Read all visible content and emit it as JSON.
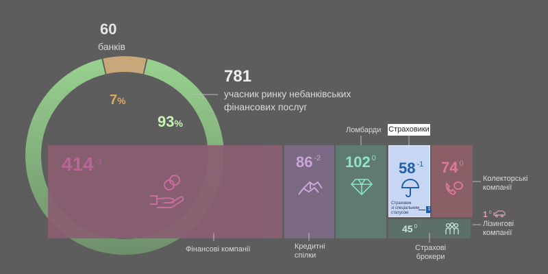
{
  "chart_data": {
    "type": "pie",
    "slices": [
      {
        "name": "банків",
        "count": 60,
        "percent": 7,
        "color": "#c8a87a"
      },
      {
        "name": "учасник ринку небанківських фінансових послуг",
        "count": 781,
        "percent": 93,
        "color": "#8fc28a"
      }
    ],
    "breakdown": {
      "type": "treemap",
      "items": [
        {
          "label": "Фінансові компанії",
          "value": 414,
          "change": "-3",
          "color": "#8a5f72",
          "text_color": "#c0679a",
          "icon": "hand-coins-icon"
        },
        {
          "label": "Кредитні спілки",
          "value": 86,
          "change": "-2",
          "color": "#7b6882",
          "text_color": "#c9a6d6",
          "icon": "handshake-icon"
        },
        {
          "label": "Ломбарди",
          "value": 102,
          "change": "0",
          "color": "#5f7a72",
          "text_color": "#8fe3c9",
          "icon": "diamond-icon"
        },
        {
          "label": "Страховики",
          "value": 58,
          "change": "-1",
          "color": "#c6d6f3",
          "text_color": "#1f5ea8",
          "icon": "umbrella-icon",
          "highlighted": true,
          "note": "Страховик зі спеціальним статусом",
          "note_value": 1
        },
        {
          "label": "Колекторські компанії",
          "value": 74,
          "change": "0",
          "color": "#8a5f66",
          "text_color": "#e07a9a",
          "icon": "phone-chat-icon"
        },
        {
          "label": "Страхові брокери",
          "value": 45,
          "change": "0",
          "color": "#5c6f69",
          "text_color": "#c9e8d9",
          "icon": "people-icon"
        },
        {
          "label": "Лізингові компанії",
          "value": 1,
          "change": "0",
          "color": "#5d5d5d",
          "text_color": "#d9a2c0",
          "icon": "car-icon"
        }
      ]
    }
  },
  "labels": {
    "banks_count": "60",
    "banks_label": "банків",
    "banks_pct": "7",
    "nbfi_count": "781",
    "nbfi_label_1": "учасник ринку небанківських",
    "nbfi_label_2": "фінансових послуг",
    "nbfi_pct": "93",
    "pct_sign": "%",
    "fin_label": "Фінансові компанії",
    "credit_label_1": "Кредитні",
    "credit_label_2": "спілки",
    "pawn_label": "Ломбарди",
    "ins_label": "Страховики",
    "collect_label_1": "Колекторські",
    "collect_label_2": "компанії",
    "lease_label_1": "Лізингові",
    "lease_label_2": "компанії",
    "brokers_label_1": "Страхові",
    "brokers_label_2": "брокери",
    "ins_note_1": "Страховик",
    "ins_note_2": "зі спеціальним",
    "ins_note_3": "статусом"
  }
}
